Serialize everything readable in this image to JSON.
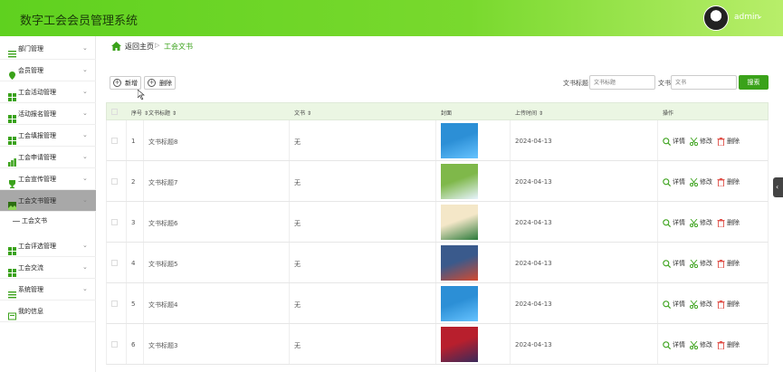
{
  "header": {
    "title": "数字工会会员管理系统",
    "user": "admin",
    "caret": "⌄"
  },
  "sidebar": {
    "items": [
      {
        "label": "部门管理",
        "icon": "list-icon"
      },
      {
        "label": "会员管理",
        "icon": "pin-icon"
      },
      {
        "label": "工会活动管理",
        "icon": "grid-icon"
      },
      {
        "label": "活动报名管理",
        "icon": "grid-icon"
      },
      {
        "label": "工会填报管理",
        "icon": "grid-icon"
      },
      {
        "label": "工会申请管理",
        "icon": "chart-icon"
      },
      {
        "label": "工会宣传管理",
        "icon": "trophy-icon"
      },
      {
        "label": "工会文书管理",
        "icon": "image-icon"
      },
      {
        "label": "工会评选管理",
        "icon": "grid-icon"
      },
      {
        "label": "工会交流",
        "icon": "grid-icon"
      },
      {
        "label": "系统管理",
        "icon": "list-icon"
      },
      {
        "label": "我的信息",
        "icon": "card-icon"
      }
    ],
    "sub_item": "工会文书",
    "chevron": "⌄"
  },
  "breadcrumb": {
    "home": "返回主页",
    "separator": "▷",
    "current": "工会文书"
  },
  "toolbar": {
    "add": "新增",
    "delete": "删除"
  },
  "filters": {
    "title_label": "文书标题",
    "title_placeholder": "文书标题",
    "doc_label": "文书",
    "doc_placeholder": "文书",
    "search": "搜索"
  },
  "table": {
    "headers": [
      "序号",
      "文书标题",
      "文书",
      "封面",
      "上传时间",
      "操作"
    ],
    "sort_mark": "⇕",
    "rows": [
      {
        "no": "1",
        "title": "文书标题8",
        "doc": "无",
        "date": "2024-04-13"
      },
      {
        "no": "2",
        "title": "文书标题7",
        "doc": "无",
        "date": "2024-04-13"
      },
      {
        "no": "3",
        "title": "文书标题6",
        "doc": "无",
        "date": "2024-04-13"
      },
      {
        "no": "4",
        "title": "文书标题5",
        "doc": "无",
        "date": "2024-04-13"
      },
      {
        "no": "5",
        "title": "文书标题4",
        "doc": "无",
        "date": "2024-04-13"
      },
      {
        "no": "6",
        "title": "文书标题3",
        "doc": "无",
        "date": "2024-04-13"
      }
    ],
    "actions": {
      "detail": "详情",
      "edit": "修改",
      "delete": "删除"
    }
  },
  "colors": {
    "accent": "#3aa21a",
    "header_green": "#5fd11f",
    "active_menu": "#a8a8a8",
    "delete_red": "#e0524a"
  }
}
